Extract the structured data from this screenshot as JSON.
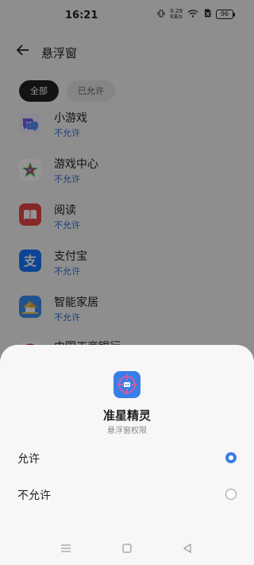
{
  "status": {
    "time": "16:21",
    "speed_value": "0.29",
    "speed_unit": "KB/s",
    "battery": "96"
  },
  "header": {
    "title": "悬浮窗",
    "back_icon": "arrow-left-icon"
  },
  "tabs": [
    {
      "label": "全部",
      "active": true
    },
    {
      "label": "已允许",
      "active": false
    }
  ],
  "apps": [
    {
      "name": "小游戏",
      "status": "不允许",
      "icon": "mini-games-icon"
    },
    {
      "name": "游戏中心",
      "status": "不允许",
      "icon": "game-center-icon"
    },
    {
      "name": "阅读",
      "status": "不允许",
      "icon": "reading-icon"
    },
    {
      "name": "支付宝",
      "status": "不允许",
      "icon": "alipay-icon"
    },
    {
      "name": "智能家居",
      "status": "不允许",
      "icon": "smart-home-icon"
    },
    {
      "name": "中国工商银行",
      "status": "",
      "icon": "icbc-icon"
    }
  ],
  "sheet": {
    "app_name": "准星精灵",
    "subtitle": "悬浮窗权限",
    "icon": "crosshair-app-icon",
    "options": [
      {
        "label": "允许",
        "selected": true
      },
      {
        "label": "不允许",
        "selected": false
      }
    ]
  },
  "colors": {
    "accent": "#3a7ee8",
    "status_text": "#2f6fd6"
  }
}
